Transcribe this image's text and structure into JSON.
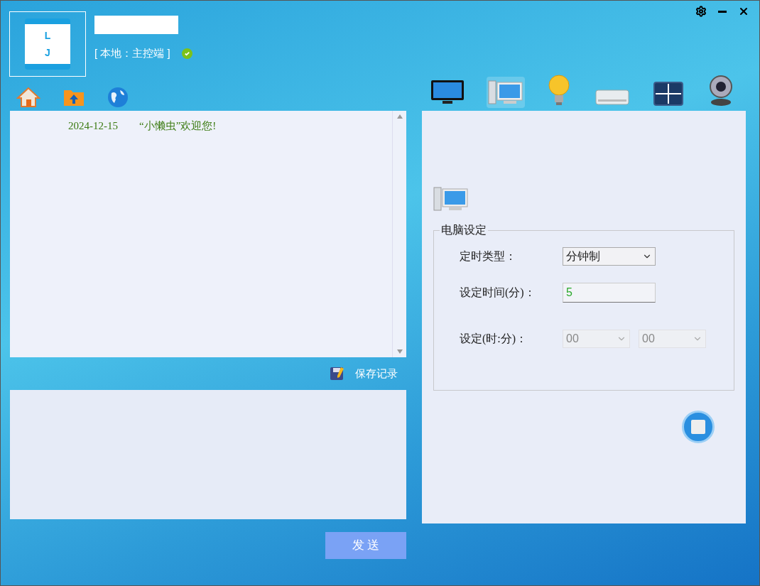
{
  "logo": {
    "letters": [
      "L",
      "J"
    ]
  },
  "status": {
    "text": "[ 本地：主控端 ]",
    "online": true
  },
  "chat": {
    "messages": [
      {
        "date": "2024-12-15",
        "text": "“小懒虫”欢迎您!"
      }
    ]
  },
  "save_button": "保存记录",
  "send_button": "发 送",
  "devices": [
    {
      "kind": "tv",
      "selected": false
    },
    {
      "kind": "computer",
      "selected": true
    },
    {
      "kind": "bulb",
      "selected": false
    },
    {
      "kind": "aircon",
      "selected": false
    },
    {
      "kind": "curtain",
      "selected": false
    },
    {
      "kind": "webcam",
      "selected": false
    }
  ],
  "settings": {
    "title": "电脑设定",
    "rows": [
      {
        "kind": "select",
        "label": "定时类型：",
        "values": [
          "分钟制"
        ],
        "disabled": false
      },
      {
        "kind": "input",
        "label": "设定时间(分)：",
        "values": [
          "5"
        ],
        "disabled": false
      },
      {
        "kind": "select",
        "label": "设定(时:分)：",
        "values": [
          "00",
          "00"
        ],
        "disabled": true
      }
    ]
  }
}
